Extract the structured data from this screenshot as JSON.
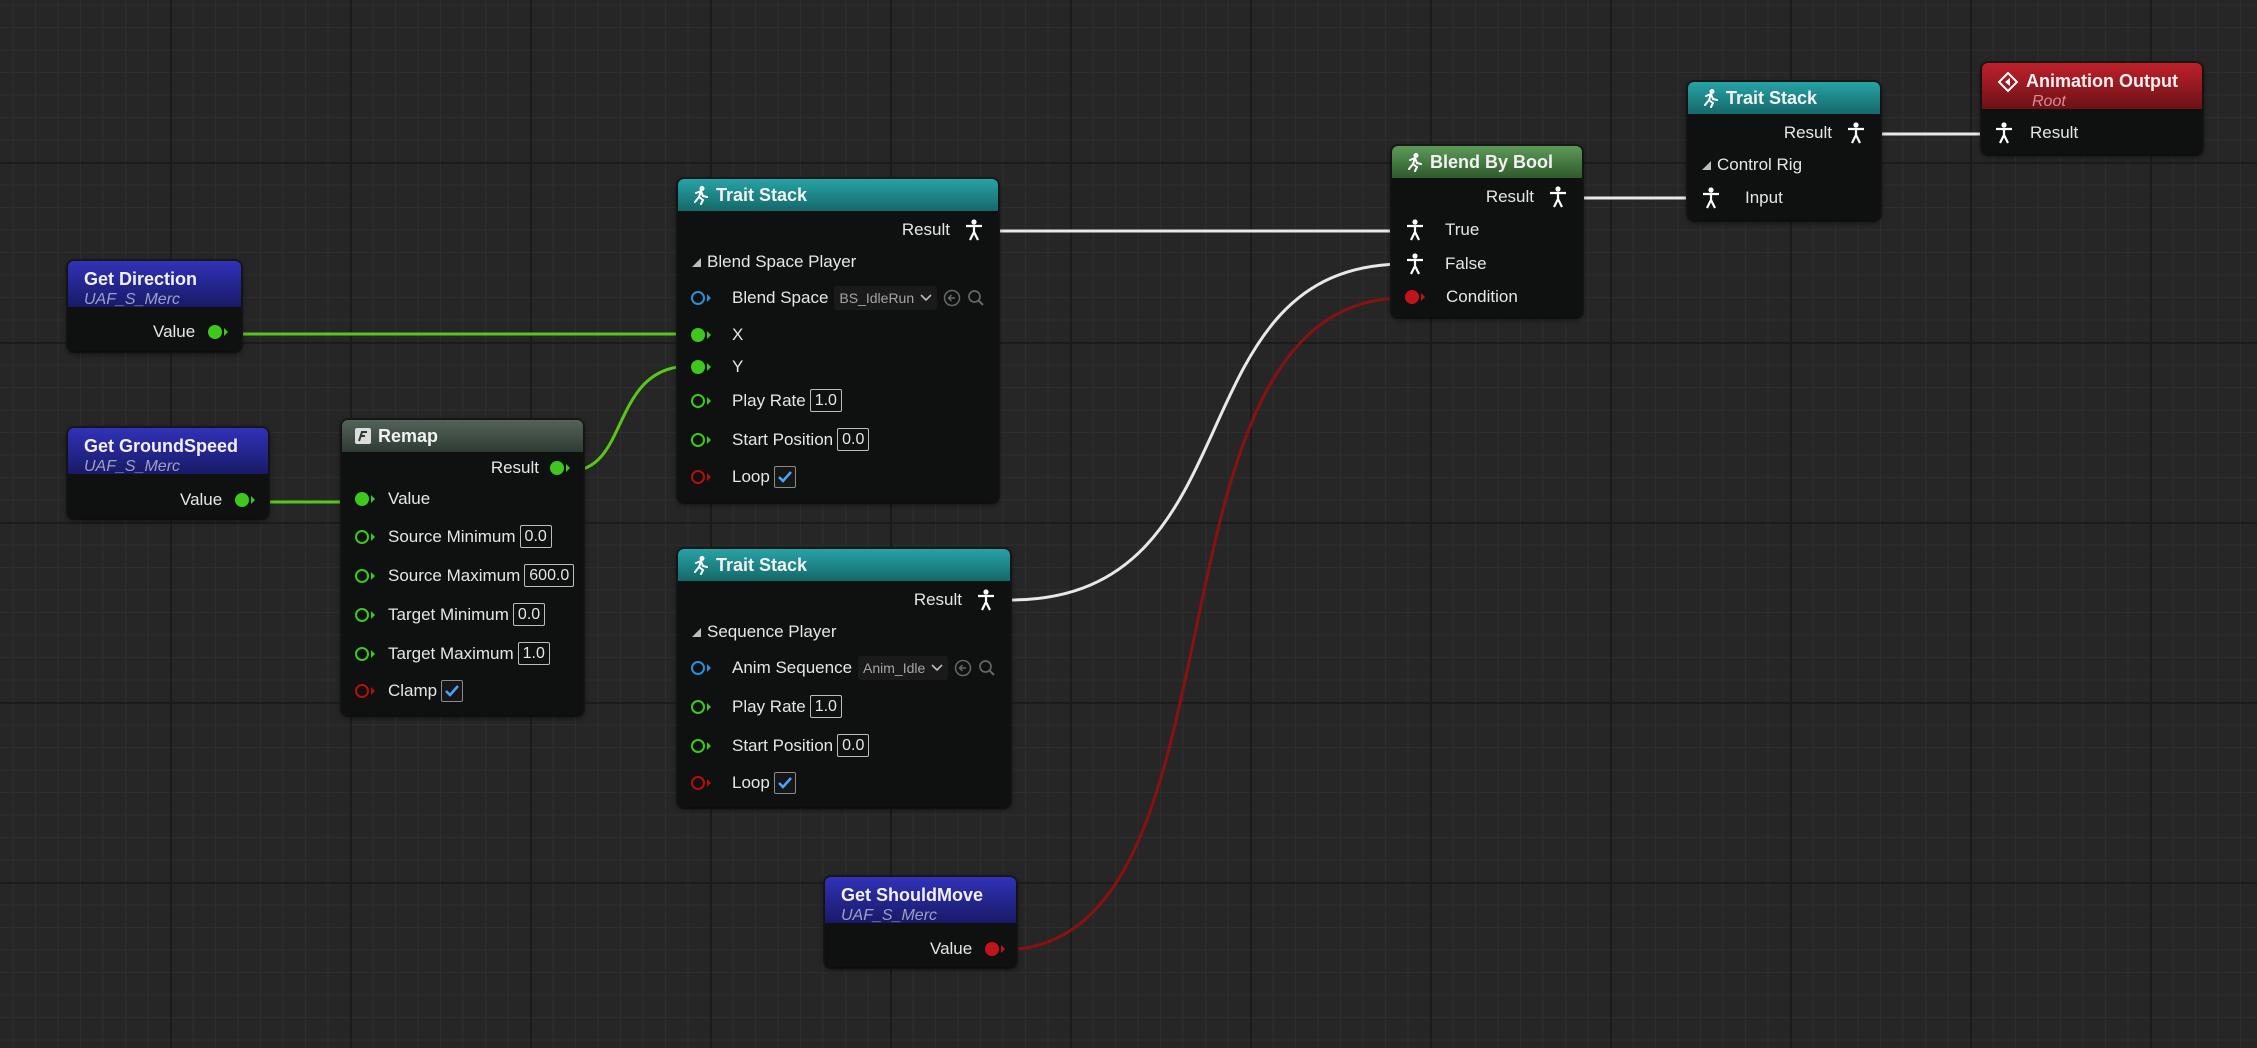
{
  "colors": {
    "float_pin": "#3ec81e",
    "bool_pin": "#b30f0f",
    "object_pin": "#2d8fd5",
    "pose_wire": "#e8e8e8",
    "float_wire": "#57c81b",
    "bool_wire": "#8a1111"
  },
  "nodes": {
    "get_direction": {
      "title": "Get Direction",
      "subtitle": "UAF_S_Merc",
      "value_label": "Value"
    },
    "get_groundspeed": {
      "title": "Get GroundSpeed",
      "subtitle": "UAF_S_Merc",
      "value_label": "Value"
    },
    "remap": {
      "title": "Remap",
      "result_label": "Result",
      "value_label": "Value",
      "source_min_label": "Source Minimum",
      "source_min": "0.0",
      "source_max_label": "Source Maximum",
      "source_max": "600.0",
      "target_min_label": "Target Minimum",
      "target_min": "0.0",
      "target_max_label": "Target Maximum",
      "target_max": "1.0",
      "clamp_label": "Clamp",
      "clamp_checked": true
    },
    "trait_stack_1": {
      "title": "Trait Stack",
      "result_label": "Result",
      "section": "Blend Space Player",
      "blend_space_label": "Blend Space",
      "blend_space_value": "BS_IdleRun",
      "x_label": "X",
      "y_label": "Y",
      "play_rate_label": "Play Rate",
      "play_rate": "1.0",
      "start_position_label": "Start Position",
      "start_position": "0.0",
      "loop_label": "Loop",
      "loop_checked": true
    },
    "trait_stack_2": {
      "title": "Trait Stack",
      "result_label": "Result",
      "section": "Sequence Player",
      "anim_sequence_label": "Anim Sequence",
      "anim_sequence_value": "Anim_Idle",
      "play_rate_label": "Play Rate",
      "play_rate": "1.0",
      "start_position_label": "Start Position",
      "start_position": "0.0",
      "loop_label": "Loop",
      "loop_checked": true
    },
    "get_shouldmove": {
      "title": "Get ShouldMove",
      "subtitle": "UAF_S_Merc",
      "value_label": "Value"
    },
    "blend_by_bool": {
      "title": "Blend By Bool",
      "result_label": "Result",
      "true_label": "True",
      "false_label": "False",
      "condition_label": "Condition"
    },
    "trait_stack_3": {
      "title": "Trait Stack",
      "result_label": "Result",
      "section": "Control Rig",
      "input_label": "Input"
    },
    "animation_output": {
      "title": "Animation Output",
      "subtitle": "Root",
      "result_label": "Result"
    }
  },
  "icons": {
    "trait_stack_header": "running-person-icon",
    "blend_by_bool_header": "running-person-icon",
    "remap_header": "function-icon",
    "animation_output_header": "diamond-output-icon",
    "pose_pin": "person-pose-icon",
    "browse": "arrow-left-circle-icon",
    "find": "magnifier-icon",
    "dropdown": "chevron-down-icon",
    "checkbox": "checkmark-icon"
  }
}
